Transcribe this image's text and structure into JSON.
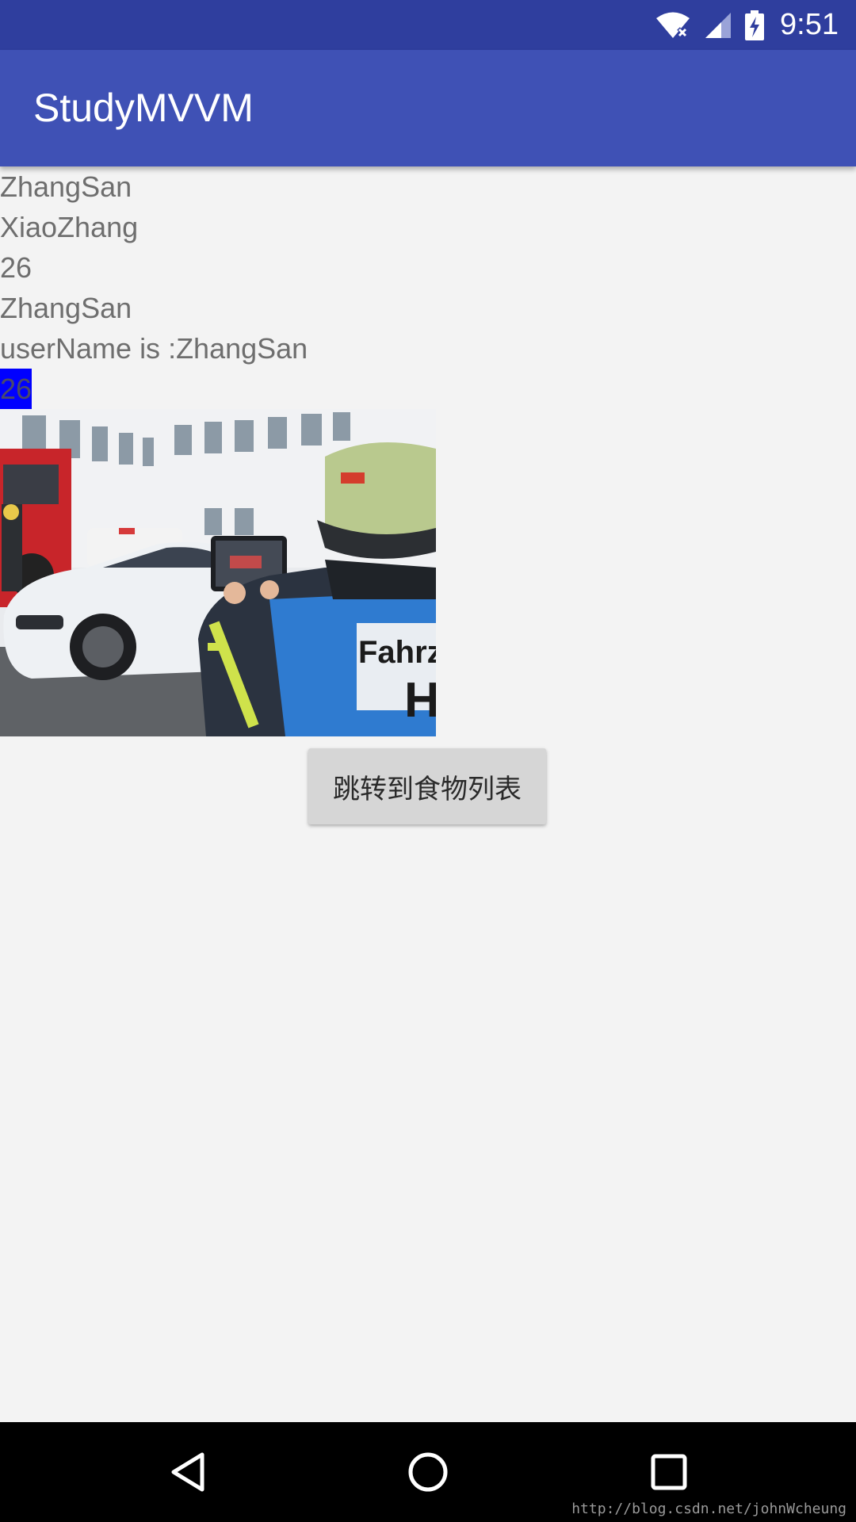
{
  "status_bar": {
    "time": "9:51",
    "icons": [
      "wifi-icon",
      "signal-icon",
      "battery-charging-icon"
    ]
  },
  "app_bar": {
    "title": "StudyMVVM"
  },
  "content": {
    "lines": [
      "ZhangSan",
      "XiaoZhang",
      "26",
      "ZhangSan",
      "userName is :ZhangSan"
    ],
    "highlighted_value": "26",
    "highlight_color": "#0000ff",
    "image": "firefighter-with-tablet-photo",
    "button_label": "跳转到食物列表"
  },
  "nav_bar": {
    "buttons": [
      "back-icon",
      "home-icon",
      "recents-icon"
    ]
  },
  "watermark": "http://blog.csdn.net/johnWcheung",
  "colors": {
    "status_bar": "#2f3e9e",
    "app_bar": "#3f51b5",
    "background": "#f3f3f3"
  }
}
